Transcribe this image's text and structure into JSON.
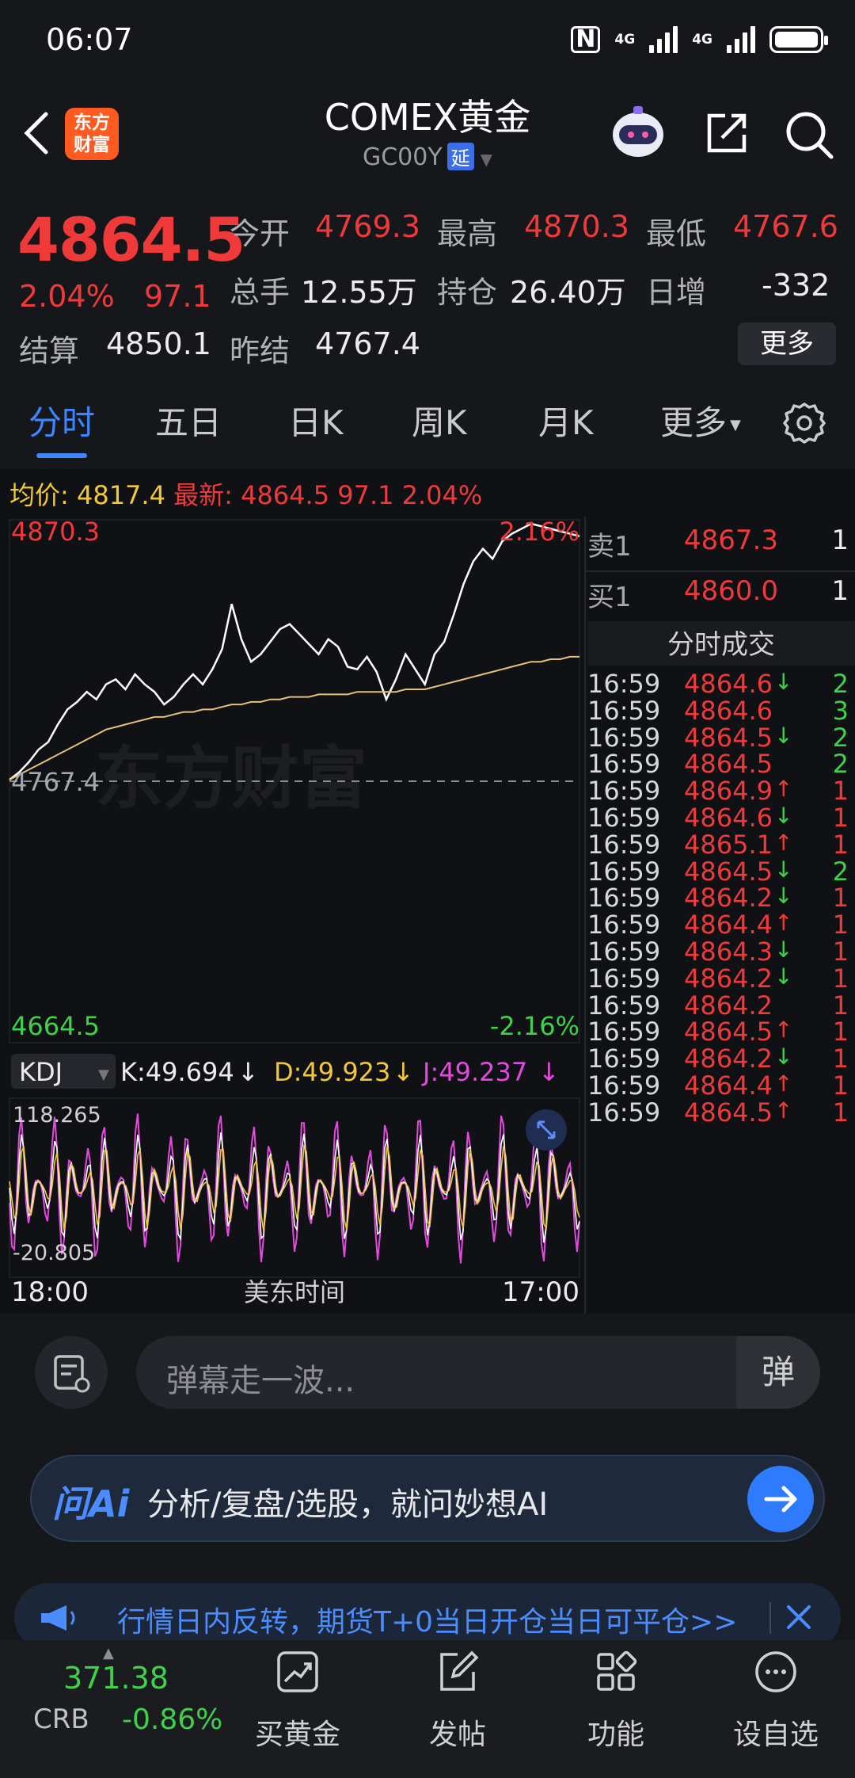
{
  "status_bar": {
    "time": "06:07",
    "network1": "4G",
    "network2": "4G"
  },
  "header": {
    "app_logo": "东方财富",
    "title": "COMEX黄金",
    "code": "GC00Y",
    "delay_badge": "延"
  },
  "quote": {
    "price": "4864.5",
    "change_pct": "2.04%",
    "change": "97.1",
    "stats": [
      {
        "label": "今开",
        "value": "4769.3",
        "color": "red"
      },
      {
        "label": "最高",
        "value": "4870.3",
        "color": "red"
      },
      {
        "label": "最低",
        "value": "4767.6",
        "color": "red"
      },
      {
        "label": "总手",
        "value": "12.55万",
        "color": "white"
      },
      {
        "label": "持仓",
        "value": "26.40万",
        "color": "white"
      },
      {
        "label": "日增",
        "value": "-332",
        "color": "white"
      },
      {
        "label": "结算",
        "value": "4850.1",
        "color": "white"
      },
      {
        "label": "昨结",
        "value": "4767.4",
        "color": "white"
      }
    ],
    "more_label": "更多"
  },
  "tabs": [
    "分时",
    "五日",
    "日K",
    "周K",
    "月K",
    "更多"
  ],
  "active_tab": "分时",
  "intraday": {
    "avg_label": "均价:",
    "avg_value": "4817.4",
    "latest_label": "最新:",
    "latest_value": "4864.5",
    "latest_change": "97.1",
    "latest_pct": "2.04%",
    "y_high": "4870.3",
    "y_high_pct": "2.16%",
    "y_mid": "4767.4",
    "y_low": "4664.5",
    "y_low_pct": "-2.16%",
    "watermark": "东方财富",
    "time_start": "18:00",
    "time_label": "美东时间",
    "time_end": "17:00"
  },
  "kdj": {
    "selector": "KDJ",
    "k": "K:49.694",
    "d": "D:49.923",
    "j": "J:49.237",
    "y_high": "118.265",
    "y_low": "-20.805"
  },
  "order_book": {
    "sell": {
      "label": "卖1",
      "price": "4867.3",
      "qty": "1"
    },
    "buy": {
      "label": "买1",
      "price": "4860.0",
      "qty": "1"
    },
    "ticks_title": "分时成交",
    "ticks": [
      {
        "time": "16:59",
        "price": "4864.6",
        "dir": "down",
        "qty": "2"
      },
      {
        "time": "16:59",
        "price": "4864.6",
        "dir": "",
        "qty": "3"
      },
      {
        "time": "16:59",
        "price": "4864.5",
        "dir": "down",
        "qty": "2"
      },
      {
        "time": "16:59",
        "price": "4864.5",
        "dir": "",
        "qty": "2"
      },
      {
        "time": "16:59",
        "price": "4864.9",
        "dir": "up",
        "qty": "1"
      },
      {
        "time": "16:59",
        "price": "4864.6",
        "dir": "down",
        "qty": "1"
      },
      {
        "time": "16:59",
        "price": "4865.1",
        "dir": "up",
        "qty": "1"
      },
      {
        "time": "16:59",
        "price": "4864.5",
        "dir": "down",
        "qty": "2"
      },
      {
        "time": "16:59",
        "price": "4864.2",
        "dir": "down",
        "qty": "1"
      },
      {
        "time": "16:59",
        "price": "4864.4",
        "dir": "up",
        "qty": "1"
      },
      {
        "time": "16:59",
        "price": "4864.3",
        "dir": "down",
        "qty": "1"
      },
      {
        "time": "16:59",
        "price": "4864.2",
        "dir": "down",
        "qty": "1"
      },
      {
        "time": "16:59",
        "price": "4864.2",
        "dir": "",
        "qty": "1"
      },
      {
        "time": "16:59",
        "price": "4864.5",
        "dir": "up",
        "qty": "1"
      },
      {
        "time": "16:59",
        "price": "4864.2",
        "dir": "down",
        "qty": "1"
      },
      {
        "time": "16:59",
        "price": "4864.4",
        "dir": "up",
        "qty": "1"
      },
      {
        "time": "16:59",
        "price": "4864.5",
        "dir": "up",
        "qty": "1"
      }
    ]
  },
  "comment": {
    "placeholder": "弹幕走一波...",
    "danmu_button": "弹"
  },
  "ai_bar": {
    "logo": "问Ai",
    "text": "分析/复盘/选股，就问妙想AI"
  },
  "ticker": {
    "text": "行情日内反转，期货T+0当日开仓当日可平仓>>"
  },
  "bottom_nav": {
    "crb_value": "371.38",
    "crb_label": "CRB",
    "crb_pct": "-0.86%",
    "items": [
      "买黄金",
      "发帖",
      "功能",
      "设自选"
    ]
  },
  "colors": {
    "up": "#f03a3a",
    "down": "#3fd14a",
    "accent": "#3d86ff",
    "avg_line": "#e6c07a",
    "kdj_k": "#f2c73a",
    "kdj_j": "#e24adf"
  },
  "chart_data": {
    "type": "line",
    "series": [
      {
        "name": "最新",
        "values": [
          4768,
          4771,
          4775,
          4780,
          4783,
          4790,
          4796,
          4799,
          4803,
          4800,
          4806,
          4808,
          4804,
          4810,
          4806,
          4803,
          4798,
          4801,
          4806,
          4810,
          4806,
          4812,
          4820,
          4838,
          4824,
          4815,
          4818,
          4823,
          4828,
          4830,
          4826,
          4822,
          4818,
          4824,
          4821,
          4813,
          4812,
          4817,
          4811,
          4800,
          4808,
          4818,
          4812,
          4806,
          4818,
          4823,
          4834,
          4846,
          4855,
          4860,
          4856,
          4863,
          4866,
          4868,
          4870,
          4869,
          4868,
          4867,
          4866,
          4865
        ]
      },
      {
        "name": "均价",
        "values": [
          4768,
          4770,
          4772,
          4774,
          4776,
          4778,
          4780,
          4782,
          4784,
          4786,
          4788,
          4789,
          4790,
          4791,
          4792,
          4793,
          4793,
          4794,
          4795,
          4795,
          4796,
          4796,
          4797,
          4798,
          4798,
          4799,
          4799,
          4800,
          4800,
          4801,
          4801,
          4801,
          4802,
          4802,
          4802,
          4802,
          4803,
          4803,
          4803,
          4803,
          4803,
          4804,
          4804,
          4804,
          4805,
          4806,
          4807,
          4808,
          4809,
          4810,
          4811,
          4812,
          4813,
          4814,
          4815,
          4815,
          4816,
          4816,
          4817,
          4817
        ]
      }
    ],
    "ylim": [
      4664.5,
      4870.3
    ],
    "xlabel": "美东时间",
    "x_ticks": [
      "18:00",
      "17:00"
    ]
  }
}
